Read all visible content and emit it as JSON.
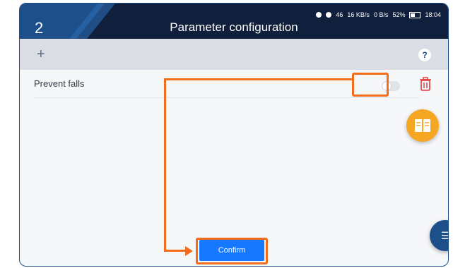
{
  "step": "2",
  "header": {
    "title": "Parameter configuration"
  },
  "status_bar": {
    "signal": "46",
    "net_speed_1": "16 KB/s",
    "net_speed_2": "0 B/s",
    "battery": "52%",
    "time": "18:04"
  },
  "toolbar": {
    "add_icon": "plus-icon",
    "help_label": "?"
  },
  "settings": [
    {
      "label": "Prevent falls",
      "toggle_on": false
    }
  ],
  "confirm_label": "Confirm",
  "colors": {
    "annotation": "#f26c1c",
    "header": "#0f1f3c",
    "confirm": "#1677ff",
    "book_fab": "#f5a623"
  }
}
